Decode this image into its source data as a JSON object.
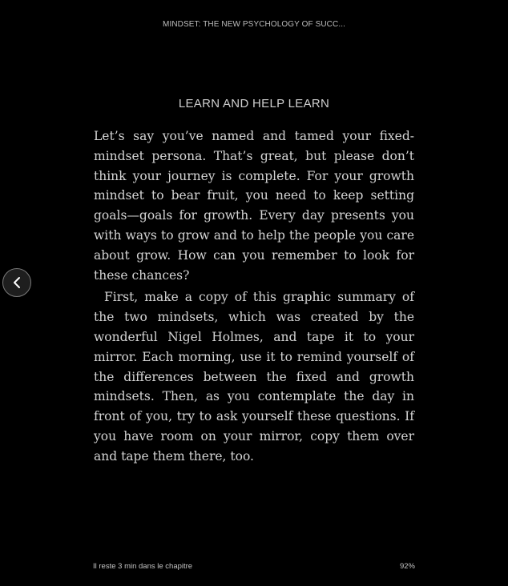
{
  "header": {
    "book_title": "MINDSET: THE NEW PSYCHOLOGY OF SUCC..."
  },
  "chapter": {
    "section_heading": "LEARN AND HELP LEARN",
    "paragraphs": [
      "Let’s say you’ve named and tamed your fixed-mind­set persona. That’s great, but please don’t think your journey is complete. For your growth mindset to bear fruit, you need to keep setting goals—goals for growth. Every day presents you with ways to grow and to help the people you care about grow. How can you remember to look for these chances?",
      "First, make a copy of this graphic summary of the two mindsets, which was created by the wonder­ful Nigel Holmes, and tape it to your mirror. Each morning, use it to remind yourself of the differences between the fixed and growth mindsets. Then, as you contemplate the day in front of you, try to ask yourself these questions. If you have room on your mirror, copy them over and tape them there, too."
    ]
  },
  "navigation": {
    "back_icon": "chevron-left-icon"
  },
  "footer": {
    "time_remaining": "Il reste 3 min dans le chapitre",
    "progress_percent": "92%"
  },
  "colors": {
    "background": "#000000",
    "text": "#d4d4d4",
    "button_border": "#7a7a7a"
  }
}
